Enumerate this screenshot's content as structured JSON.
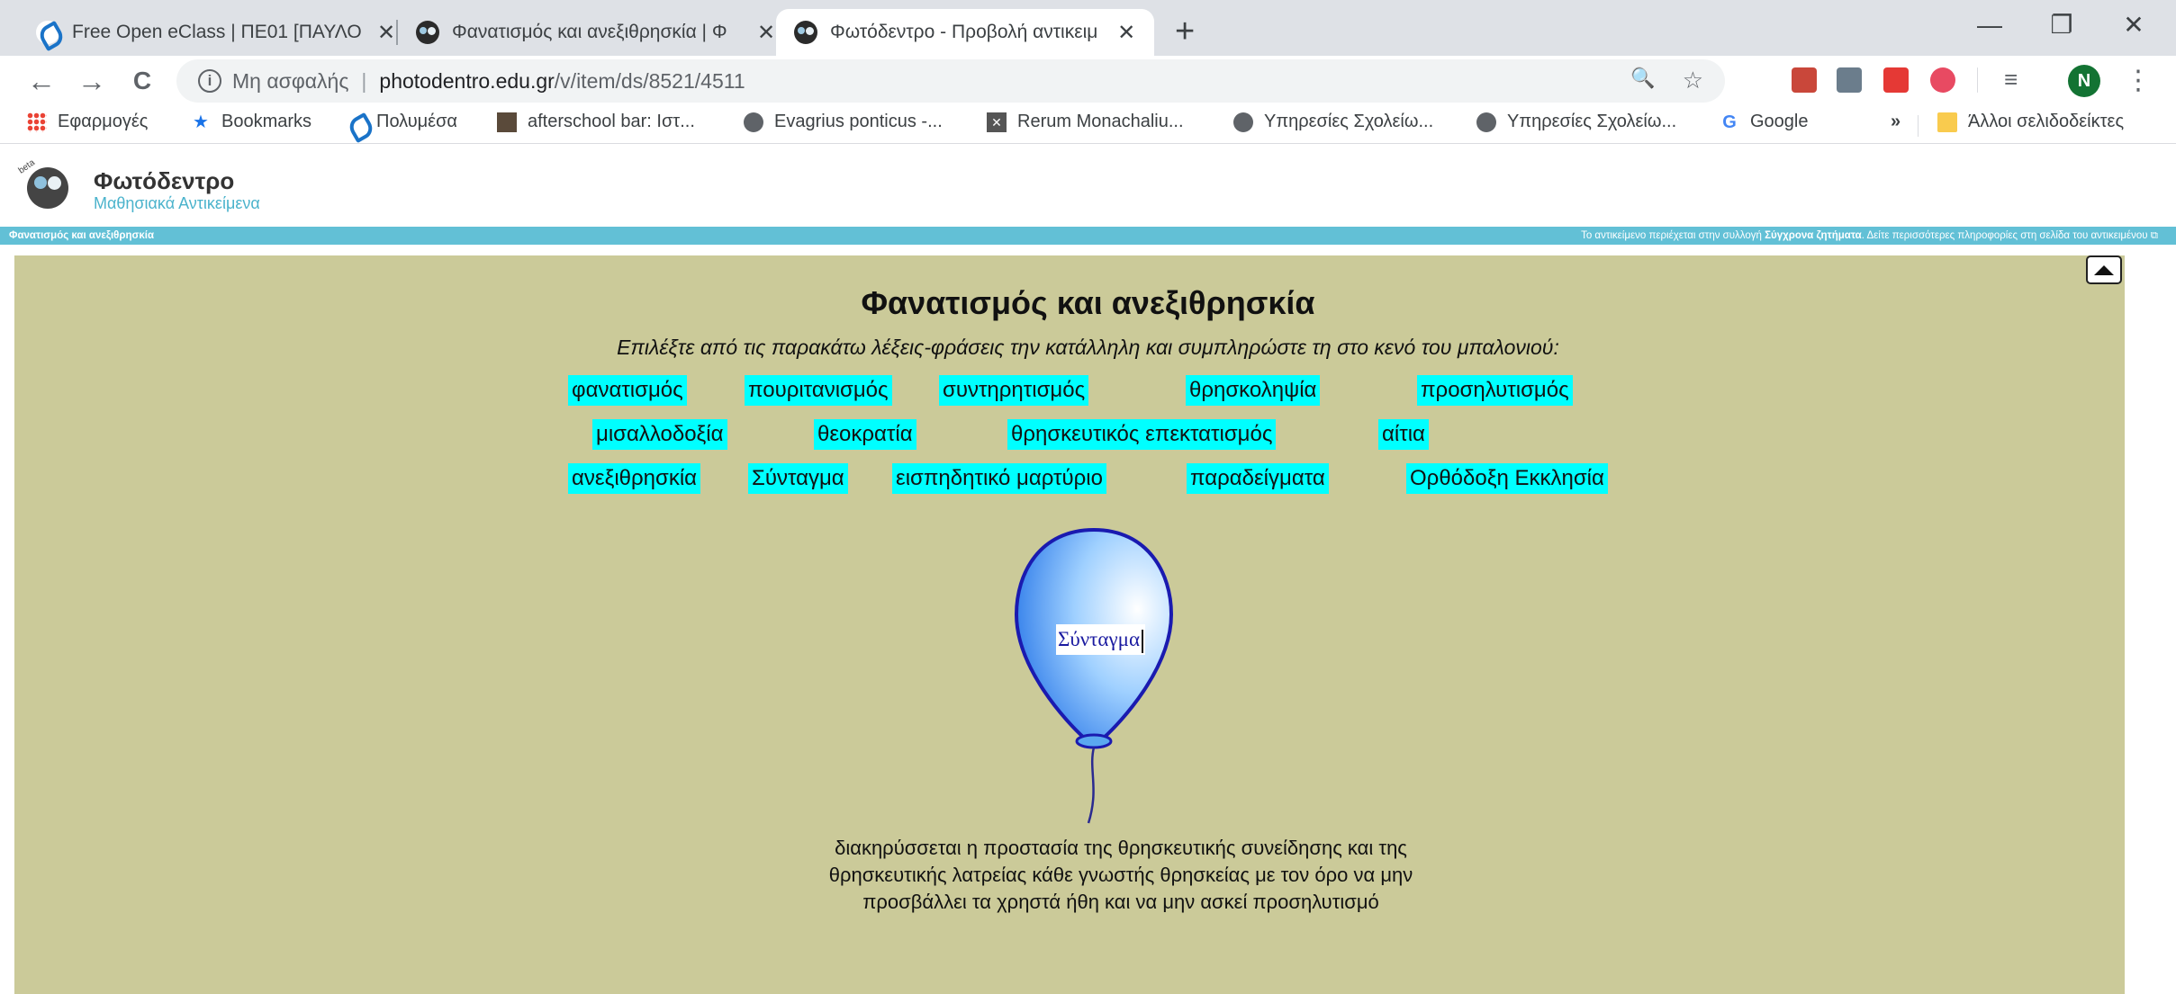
{
  "browser": {
    "tabs": [
      {
        "title": "Free Open eClass | ΠΕ01 [ΠΑΥΛΟ",
        "favicon": "eclass-icon",
        "active": false
      },
      {
        "title": "Φανατισμός και ανεξιθρησκία | Φ",
        "favicon": "photodentro-icon",
        "active": false
      },
      {
        "title": "Φωτόδεντρο - Προβολή αντικειμ",
        "favicon": "photodentro-icon",
        "active": true
      }
    ],
    "tab_close": "✕",
    "new_tab": "+",
    "window_controls": {
      "minimize": "—",
      "maximize": "❐",
      "close": "✕"
    },
    "nav": {
      "back": "←",
      "forward": "→",
      "reload": "C"
    },
    "address": {
      "security_label": "Μη ασφαλής",
      "pipe": "|",
      "host": "photodentro.edu.gr",
      "path": "/v/item/ds/8521/4511"
    },
    "zoom_icon": "🔍",
    "star_icon": "☆",
    "profile_initial": "N",
    "menu_icon": "⋮",
    "bookmarks": [
      {
        "label": "Εφαρμογές",
        "icon": "apps-icon"
      },
      {
        "label": "Bookmarks",
        "icon": "star-icon"
      },
      {
        "label": "Πολυμέσα",
        "icon": "eclass-icon"
      },
      {
        "label": "afterschool bar: Ιστ...",
        "icon": "image-icon"
      },
      {
        "label": "Evagrius ponticus -...",
        "icon": "globe-icon"
      },
      {
        "label": "Rerum Monachaliu...",
        "icon": "puzzle-icon"
      },
      {
        "label": "Υπηρεσίες Σχολείω...",
        "icon": "globe-icon"
      },
      {
        "label": "Υπηρεσίες Σχολείω...",
        "icon": "globe-icon"
      },
      {
        "label": "Google",
        "icon": "google-icon"
      }
    ],
    "bookmarks_overflow": "»",
    "other_bookmarks": "Άλλοι σελιδοδείκτες"
  },
  "site": {
    "name": "Φωτόδεντρο",
    "subtitle": "Μαθησιακά Αντικείμενα",
    "beta": "beta"
  },
  "infobar": {
    "left": "Φανατισμός και ανεξιθρησκία",
    "right_prefix": "Το αντικείμενο περιέχεται στην συλλογή ",
    "collection": "Σύγχρονα ζητήματα",
    "right_suffix": ". Δείτε περισσότερες πληροφορίες στη σελίδα του αντικειμένου",
    "external_icon": "⧉"
  },
  "activity": {
    "title": "Φανατισμός και ανεξιθρησκία",
    "instructions": "Επιλέξτε από τις παρακάτω λέξεις-φράσεις την κατάλληλη και συμπληρώστε τη στο κενό του μπαλονιού:",
    "words": [
      "φανατισμός",
      "πουριτανισμός",
      "συντηρητισμός",
      "θρησκοληψία",
      "προσηλυτισμός",
      "μισαλλοδοξία",
      "θεοκρατία",
      "θρησκευτικός επεκτατισμός",
      "αίτια",
      "ανεξιθρησκία",
      "Σύνταγμα",
      "εισπηδητικό μαρτύριο",
      "παραδείγματα",
      "Ορθόδοξη Εκκλησία"
    ],
    "balloon_answer": "Σύνταγμα",
    "definition_lines": [
      "διακηρύσσεται η προστασία της θρησκευτικής συνείδησης και της",
      "θρησκευτικής λατρείας κάθε γνωστής θρησκείας με τον όρο να μην",
      "προσβάλλει τα χρηστά ήθη και να μην ασκεί προσηλυτισμό"
    ]
  },
  "colors": {
    "stage_bg": "#cbca99",
    "word_bg": "#00ffff",
    "infobar_bg": "#62c0d6",
    "balloon_stroke": "#1a1ab0",
    "balloon_fill": "#2a8cf0"
  }
}
